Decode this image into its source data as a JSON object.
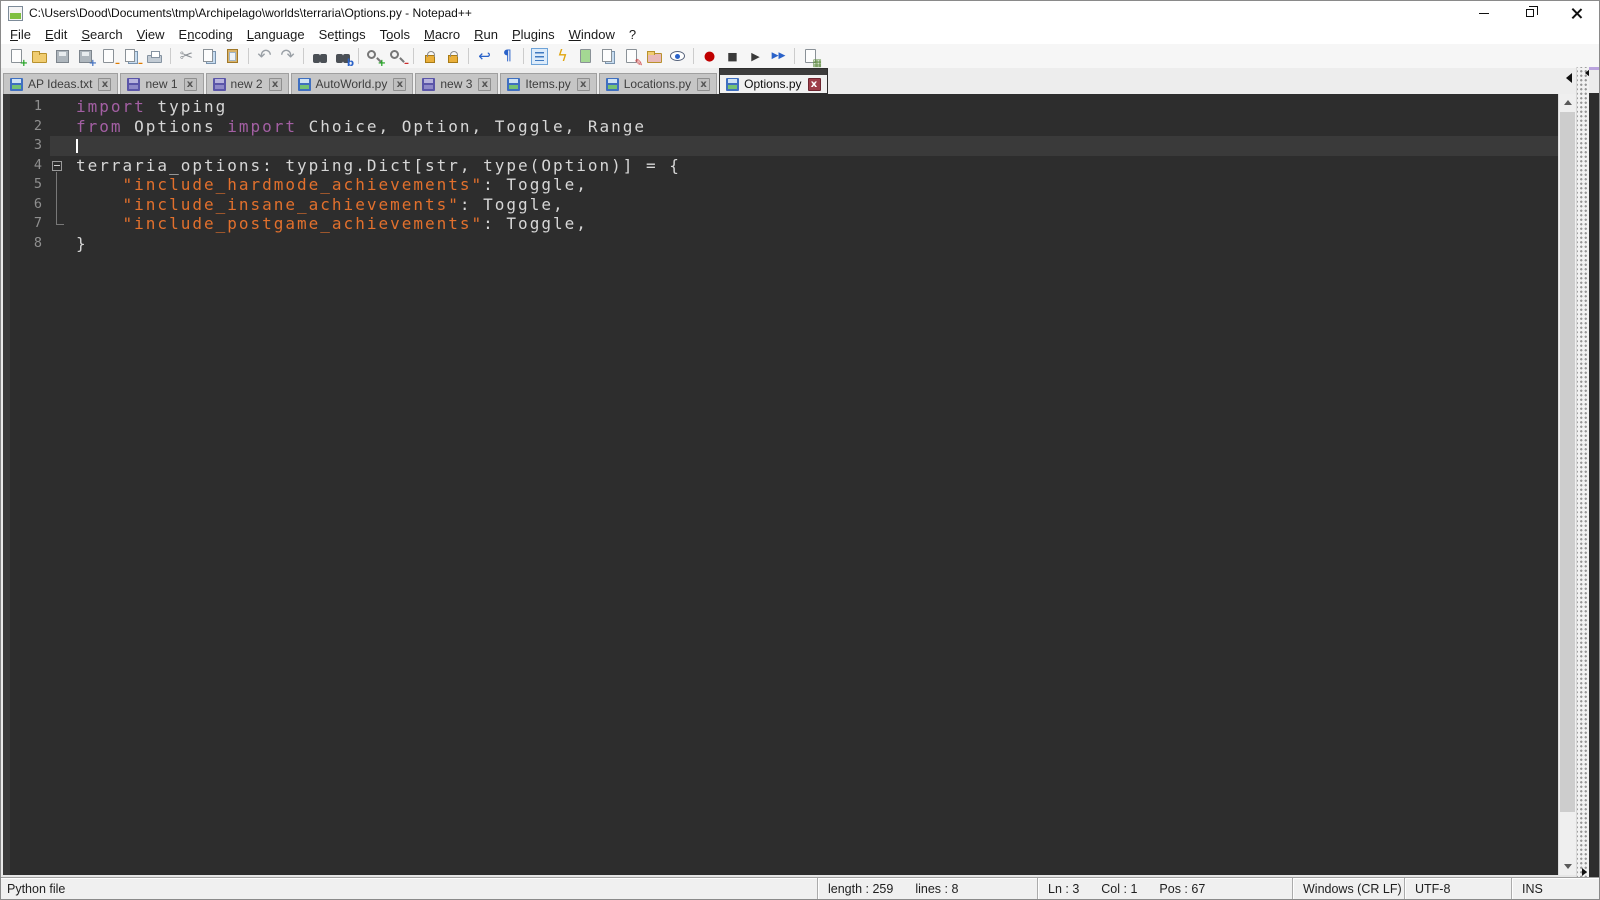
{
  "window": {
    "title": "C:\\Users\\Dood\\Documents\\tmp\\Archipelago\\worlds\\terraria\\Options.py - Notepad++",
    "app_icon": "notepad-plus-plus-icon",
    "controls": [
      "minimize",
      "restore",
      "close"
    ]
  },
  "menubar": {
    "items": [
      {
        "label": "File",
        "mnemonic": 0
      },
      {
        "label": "Edit",
        "mnemonic": 0
      },
      {
        "label": "Search",
        "mnemonic": 0
      },
      {
        "label": "View",
        "mnemonic": 0
      },
      {
        "label": "Encoding",
        "mnemonic": 1
      },
      {
        "label": "Language",
        "mnemonic": 0
      },
      {
        "label": "Settings",
        "mnemonic": 2
      },
      {
        "label": "Tools",
        "mnemonic": 1
      },
      {
        "label": "Macro",
        "mnemonic": 0
      },
      {
        "label": "Run",
        "mnemonic": 0
      },
      {
        "label": "Plugins",
        "mnemonic": 0
      },
      {
        "label": "Window",
        "mnemonic": 0
      },
      {
        "label": "?",
        "mnemonic": -1
      }
    ]
  },
  "toolbar": {
    "groups": [
      [
        "new-file",
        "open-file",
        "save-file",
        "save-all",
        "close-file",
        "close-all",
        "print"
      ],
      [
        "cut",
        "copy",
        "paste"
      ],
      [
        "undo",
        "redo"
      ],
      [
        "find",
        "replace"
      ],
      [
        "zoom-in",
        "zoom-out"
      ],
      [
        "sync-vertical-scroll",
        "sync-horizontal-scroll"
      ],
      [
        "word-wrap",
        "show-all-characters"
      ],
      [
        "show-indent-guide",
        "define-language",
        "document-map",
        "document-switcher",
        "function-list",
        "folder-as-workspace",
        "monitoring"
      ],
      [
        "macro-record",
        "macro-stop",
        "macro-play",
        "macro-run-multiple"
      ],
      [
        "macro-save"
      ]
    ]
  },
  "tabbar": {
    "close_glyph": "x",
    "scroll_left_icon": "tab-scroll-left-icon",
    "tabs": [
      {
        "label": "AP Ideas.txt",
        "icon": "floppy-saved",
        "active": false
      },
      {
        "label": "new 1",
        "icon": "floppy-unsaved",
        "active": false
      },
      {
        "label": "new 2",
        "icon": "floppy-unsaved",
        "active": false
      },
      {
        "label": "AutoWorld.py",
        "icon": "floppy-saved",
        "active": false
      },
      {
        "label": "new 3",
        "icon": "floppy-unsaved",
        "active": false
      },
      {
        "label": "Items.py",
        "icon": "floppy-saved",
        "active": false
      },
      {
        "label": "Locations.py",
        "icon": "floppy-saved",
        "active": false
      },
      {
        "label": "Options.py",
        "icon": "floppy-saved",
        "active": true
      }
    ]
  },
  "editor": {
    "palette": {
      "background": "#2d2d2d",
      "caret_line": "#3a3a3a",
      "keyword": "#a35fa3",
      "string": "#e2702d",
      "plain": "#d6d6d6",
      "line_number": "#8f8f8f",
      "caret": "#ffffff"
    },
    "caret": {
      "line": 3,
      "col": 1
    },
    "lines": [
      {
        "num": "1",
        "fold": "none",
        "tokens": [
          {
            "text": "import",
            "type": "keyword"
          },
          {
            "text": " typing",
            "type": "plain"
          }
        ]
      },
      {
        "num": "2",
        "fold": "none",
        "tokens": [
          {
            "text": "from",
            "type": "keyword"
          },
          {
            "text": " Options ",
            "type": "plain"
          },
          {
            "text": "import",
            "type": "keyword"
          },
          {
            "text": " Choice, Option, Toggle, Range",
            "type": "plain"
          }
        ]
      },
      {
        "num": "3",
        "fold": "none",
        "caret": true,
        "tokens": []
      },
      {
        "num": "4",
        "fold": "box",
        "tokens": [
          {
            "text": "terraria_options: typing.Dict[str, type(Option)] = {",
            "type": "plain"
          }
        ]
      },
      {
        "num": "5",
        "fold": "line",
        "tokens": [
          {
            "text": "    ",
            "type": "plain"
          },
          {
            "text": "\"include_hardmode_achievements\"",
            "type": "string"
          },
          {
            "text": ": Toggle,",
            "type": "plain"
          }
        ]
      },
      {
        "num": "6",
        "fold": "line",
        "tokens": [
          {
            "text": "    ",
            "type": "plain"
          },
          {
            "text": "\"include_insane_achievements\"",
            "type": "string"
          },
          {
            "text": ": Toggle,",
            "type": "plain"
          }
        ]
      },
      {
        "num": "7",
        "fold": "corner",
        "tokens": [
          {
            "text": "    ",
            "type": "plain"
          },
          {
            "text": "\"include_postgame_achievements\"",
            "type": "string"
          },
          {
            "text": ": Toggle,",
            "type": "plain"
          }
        ]
      },
      {
        "num": "8",
        "fold": "none",
        "tokens": [
          {
            "text": "}",
            "type": "plain"
          }
        ]
      }
    ]
  },
  "scrollbar": {
    "up_icon": "scroll-up-arrow-icon",
    "down_icon": "scroll-down-arrow-icon"
  },
  "splitter": {
    "top_icon": "splitter-collapse-left-icon",
    "bottom_icon": "splitter-expand-right-icon"
  },
  "second_view": {
    "partial_tab_icon": "floppy-saved"
  },
  "statusbar": {
    "doc_type": "Python file",
    "length": "length : 259",
    "lines": "lines : 8",
    "ln": "Ln : 3",
    "col": "Col : 1",
    "pos": "Pos : 67",
    "eol": "Windows (CR LF)",
    "encoding": "UTF-8",
    "typing_mode": "INS"
  }
}
